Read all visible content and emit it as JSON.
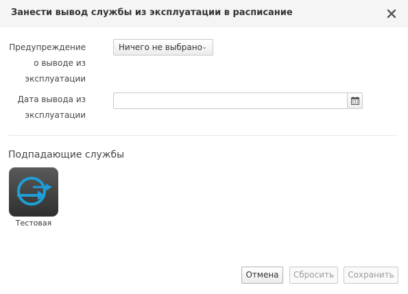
{
  "dialog": {
    "title": "Занести вывод службы из эксплуатации в расписание"
  },
  "form": {
    "warning_label_line1": "Предупреждение",
    "warning_label_line2": "о выводе из",
    "warning_label_line3": "эксплуатации",
    "warning_select_value": "Ничего не выбрано",
    "date_label_line1": "Дата вывода из",
    "date_label_line2": "эксплуатации",
    "date_input_value": ""
  },
  "services": {
    "section_title": "Подпадающие службы",
    "items": [
      {
        "name": "Тестовая",
        "icon": "service-arrow-icon"
      }
    ]
  },
  "buttons": {
    "cancel": "Отмена",
    "reset": "Сбросить",
    "save": "Сохранить"
  },
  "colors": {
    "header_bg": "#f5f5f5",
    "tile_bg": "#3f3f3f",
    "icon_accent": "#1e9fd8"
  }
}
